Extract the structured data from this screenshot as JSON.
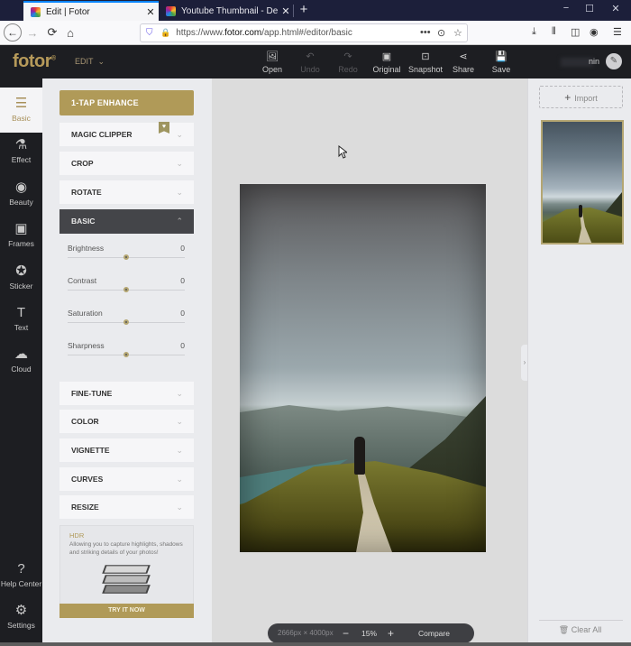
{
  "browser": {
    "tabs": [
      {
        "title": "Edit | Fotor",
        "active": true
      },
      {
        "title": "Youtube Thumbnail - Design |",
        "active": false
      }
    ],
    "new_tab": "+",
    "window_controls": {
      "minimize": "−",
      "maximize": "☐",
      "close": "✕"
    },
    "nav": {
      "back": "←",
      "forward": "→",
      "reload": "⟳",
      "home": "⌂"
    },
    "url": {
      "prefix": "https://www.",
      "domain": "fotor.com",
      "path": "/app.html#/editor/basic"
    },
    "url_icons": {
      "more": "•••",
      "pocket": "⊙",
      "bookmark": "☆"
    },
    "toolbar_icons": {
      "download": "⤓",
      "library": "⫴",
      "sidebar": "◫",
      "account": "◉",
      "menu": "☰"
    }
  },
  "app": {
    "logo": "fotor",
    "logo_mark": "®",
    "mode_menu": "EDIT",
    "mode_chevron": "⌄",
    "tools": [
      {
        "label": "Open",
        "icon": "🖼",
        "disabled": false
      },
      {
        "label": "Undo",
        "icon": "↶",
        "disabled": true
      },
      {
        "label": "Redo",
        "icon": "↷",
        "disabled": true
      },
      {
        "label": "Original",
        "icon": "▣",
        "disabled": false
      },
      {
        "label": "Snapshot",
        "icon": "⊡",
        "disabled": false
      },
      {
        "label": "Share",
        "icon": "⋖",
        "disabled": false
      },
      {
        "label": "Save",
        "icon": "💾",
        "disabled": false
      }
    ],
    "username_visible": "nin",
    "avatar_icon": "✎"
  },
  "sidebar": {
    "items": [
      {
        "label": "Basic",
        "icon": "☰",
        "active": true
      },
      {
        "label": "Effect",
        "icon": "⚗"
      },
      {
        "label": "Beauty",
        "icon": "◉"
      },
      {
        "label": "Frames",
        "icon": "▣"
      },
      {
        "label": "Sticker",
        "icon": "✪"
      },
      {
        "label": "Text",
        "icon": "T"
      },
      {
        "label": "Cloud",
        "icon": "☁"
      }
    ],
    "bottom": [
      {
        "label": "Help Center",
        "icon": "?"
      },
      {
        "label": "Settings",
        "icon": "⚙"
      }
    ]
  },
  "panel": {
    "enhance_button": "1-TAP ENHANCE",
    "sections_top": [
      {
        "label": "MAGIC CLIPPER",
        "premium_badge": true
      },
      {
        "label": "CROP"
      },
      {
        "label": "ROTATE"
      }
    ],
    "basic_section": {
      "label": "BASIC",
      "expanded": true
    },
    "sliders": [
      {
        "label": "Brightness",
        "value": "0",
        "position": 0.5
      },
      {
        "label": "Contrast",
        "value": "0",
        "position": 0.5
      },
      {
        "label": "Saturation",
        "value": "0",
        "position": 0.5
      },
      {
        "label": "Sharpness",
        "value": "0",
        "position": 0.5
      }
    ],
    "sections_bottom": [
      {
        "label": "FINE-TUNE"
      },
      {
        "label": "COLOR"
      },
      {
        "label": "VIGNETTE"
      },
      {
        "label": "CURVES"
      },
      {
        "label": "RESIZE"
      }
    ],
    "chevron_down": "⌄",
    "chevron_up": "⌃",
    "premium_icon": "♥",
    "hdr_card": {
      "title": "HDR",
      "description": "Allowing you to capture highlights, shadows and striking details of your photos!",
      "button": "TRY IT NOW"
    }
  },
  "canvas": {
    "image_size": "2666px × 4000px",
    "zoom_out": "−",
    "zoom_level": "15%",
    "zoom_in": "+",
    "compare": "Compare",
    "collapse_icon": "›"
  },
  "right_panel": {
    "import_label": "Import",
    "import_icon": "+",
    "clear_all": "Clear All",
    "clear_icon": "🗑"
  }
}
